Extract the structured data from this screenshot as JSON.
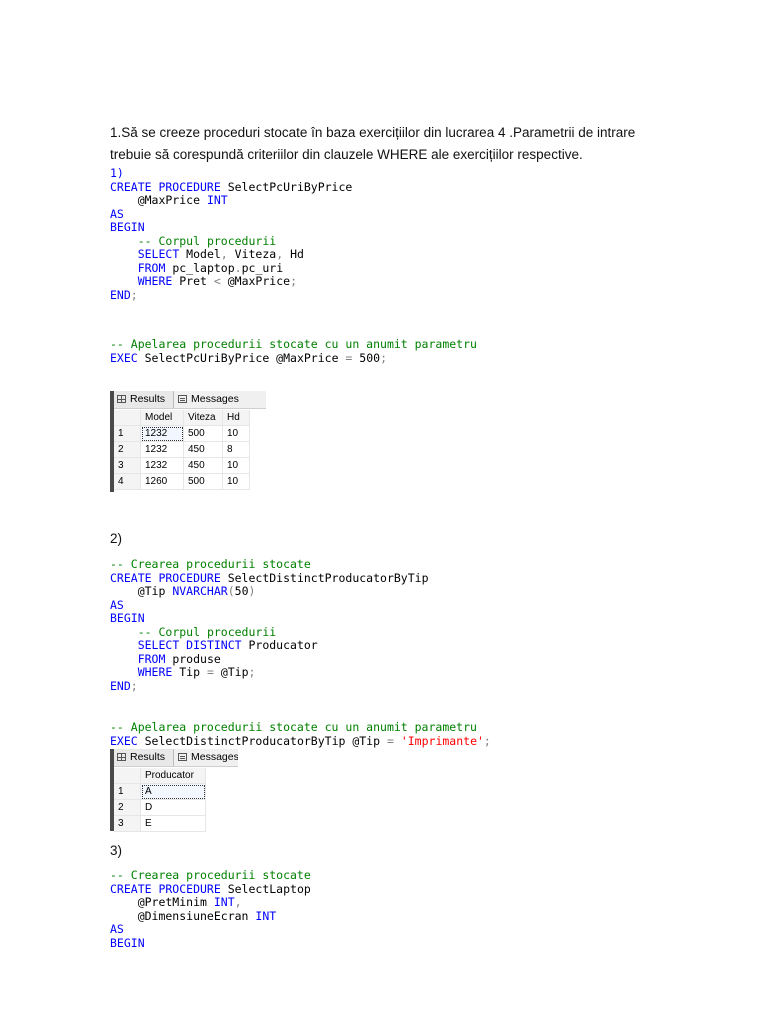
{
  "intro": "1.Să se creeze proceduri stocate în baza exercițiilor din lucrarea 4 .Parametrii de intrare trebuie să corespundă criteriilor din clauzele WHERE ale exercițiilor respective.",
  "sections": {
    "s2_label": "2)",
    "s3_label": "3)"
  },
  "code_blocks": {
    "block1": [
      [
        [
          "1)",
          "k"
        ]
      ],
      [
        [
          "CREATE PROCEDURE",
          "k"
        ],
        [
          " SelectPcUriByPrice",
          ""
        ]
      ],
      [
        [
          "    @MaxPrice ",
          ""
        ],
        [
          "INT",
          "k"
        ]
      ],
      [
        [
          "AS",
          "k"
        ]
      ],
      [
        [
          "BEGIN",
          "k"
        ]
      ],
      [
        [
          "    ",
          ""
        ],
        [
          "-- Corpul procedurii",
          "c"
        ]
      ],
      [
        [
          "    ",
          ""
        ],
        [
          "SELECT",
          "k"
        ],
        [
          " Model",
          ""
        ],
        [
          ",",
          "g"
        ],
        [
          " Viteza",
          ""
        ],
        [
          ",",
          "g"
        ],
        [
          " Hd",
          ""
        ]
      ],
      [
        [
          "    ",
          ""
        ],
        [
          "FROM",
          "k"
        ],
        [
          " pc_laptop",
          ""
        ],
        [
          ".",
          "g"
        ],
        [
          "pc_uri",
          ""
        ]
      ],
      [
        [
          "    ",
          ""
        ],
        [
          "WHERE",
          "k"
        ],
        [
          " Pret ",
          ""
        ],
        [
          "<",
          "g"
        ],
        [
          " @MaxPrice",
          ""
        ],
        [
          ";",
          "g"
        ]
      ],
      [
        [
          "END",
          "k"
        ],
        [
          ";",
          "g"
        ]
      ]
    ],
    "block1_call": [
      [
        [
          "-- Apelarea procedurii stocate cu un anumit parametru",
          "c"
        ]
      ],
      [
        [
          "EXEC",
          "k"
        ],
        [
          " SelectPcUriByPrice @MaxPrice ",
          ""
        ],
        [
          "=",
          "g"
        ],
        [
          " 500",
          ""
        ],
        [
          ";",
          "g"
        ]
      ]
    ],
    "block2": [
      [
        [
          "-- Crearea procedurii stocate",
          "c"
        ]
      ],
      [
        [
          "CREATE PROCEDURE",
          "k"
        ],
        [
          " SelectDistinctProducatorByTip",
          ""
        ]
      ],
      [
        [
          "    @Tip ",
          ""
        ],
        [
          "NVARCHAR",
          "k"
        ],
        [
          "(",
          "g"
        ],
        [
          "50",
          ""
        ],
        [
          ")",
          "g"
        ]
      ],
      [
        [
          "AS",
          "k"
        ]
      ],
      [
        [
          "BEGIN",
          "k"
        ]
      ],
      [
        [
          "    ",
          ""
        ],
        [
          "-- Corpul procedurii",
          "c"
        ]
      ],
      [
        [
          "    ",
          ""
        ],
        [
          "SELECT DISTINCT",
          "k"
        ],
        [
          " Producator",
          ""
        ]
      ],
      [
        [
          "    ",
          ""
        ],
        [
          "FROM",
          "k"
        ],
        [
          " produse",
          ""
        ]
      ],
      [
        [
          "    ",
          ""
        ],
        [
          "WHERE",
          "k"
        ],
        [
          " Tip ",
          ""
        ],
        [
          "=",
          "g"
        ],
        [
          " @Tip",
          ""
        ],
        [
          ";",
          "g"
        ]
      ],
      [
        [
          "END",
          "k"
        ],
        [
          ";",
          "g"
        ]
      ]
    ],
    "block2_call": [
      [
        [
          "-- Apelarea procedurii stocate cu un anumit parametru",
          "c"
        ]
      ],
      [
        [
          "EXEC",
          "k"
        ],
        [
          " SelectDistinctProducatorByTip @Tip ",
          ""
        ],
        [
          "=",
          "g"
        ],
        [
          " ",
          ""
        ],
        [
          "'Imprimante'",
          "s"
        ],
        [
          ";",
          "g"
        ]
      ]
    ],
    "block3": [
      [
        [
          "-- Crearea procedurii stocate",
          "c"
        ]
      ],
      [
        [
          "CREATE PROCEDURE",
          "k"
        ],
        [
          " SelectLaptop",
          ""
        ]
      ],
      [
        [
          "    @PretMinim ",
          ""
        ],
        [
          "INT",
          "k"
        ],
        [
          ",",
          "g"
        ]
      ],
      [
        [
          "    @DimensiuneEcran ",
          ""
        ],
        [
          "INT",
          "k"
        ]
      ],
      [
        [
          "AS",
          "k"
        ]
      ],
      [
        [
          "BEGIN",
          "k"
        ]
      ]
    ]
  },
  "grid1": {
    "tabs": {
      "results": "Results",
      "messages": "Messages"
    },
    "columns": [
      "Model",
      "Viteza",
      "Hd"
    ],
    "rows": [
      [
        "1",
        "1232",
        "500",
        "10"
      ],
      [
        "2",
        "1232",
        "450",
        "8"
      ],
      [
        "3",
        "1232",
        "450",
        "10"
      ],
      [
        "4",
        "1260",
        "500",
        "10"
      ]
    ]
  },
  "grid2": {
    "tabs": {
      "results": "Results",
      "messages": "Messages"
    },
    "columns": [
      "Producator"
    ],
    "rows": [
      [
        "1",
        "A"
      ],
      [
        "2",
        "D"
      ],
      [
        "3",
        "E"
      ]
    ]
  },
  "colors": {
    "keyword": "#0000ff",
    "comment": "#008000",
    "string": "#ff0000",
    "operator": "#808080"
  }
}
